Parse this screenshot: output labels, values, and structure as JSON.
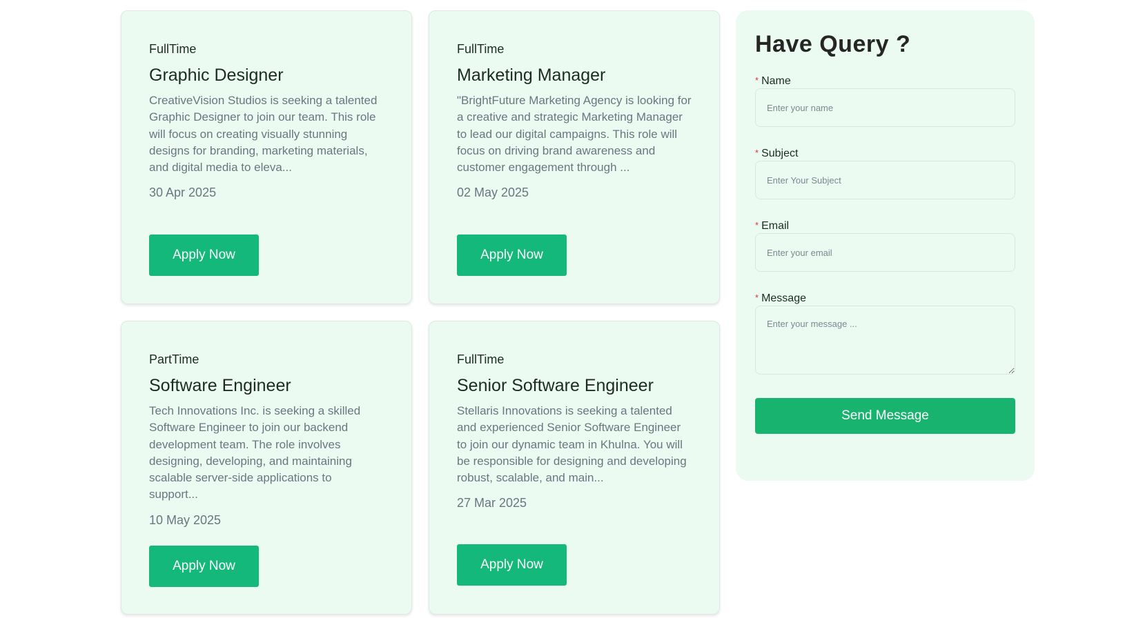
{
  "jobs": [
    {
      "type": "FullTime",
      "title": "Graphic Designer",
      "description": "CreativeVision Studios is seeking a talented Graphic Designer to join our team. This role will focus on creating visually stunning designs for branding, marketing materials, and digital media to eleva...",
      "date": "30 Apr 2025",
      "apply_label": "Apply Now"
    },
    {
      "type": "FullTime",
      "title": "Marketing Manager",
      "description": "\"BrightFuture Marketing Agency is looking for a creative and strategic Marketing Manager to lead our digital campaigns. This role will focus on driving brand awareness and customer engagement through ...",
      "date": "02 May 2025",
      "apply_label": "Apply Now"
    },
    {
      "type": "PartTime",
      "title": "Software Engineer",
      "description": "Tech Innovations Inc. is seeking a skilled Software Engineer to join our backend development team. The role involves designing, developing, and maintaining scalable server-side applications to support...",
      "date": "10 May 2025",
      "apply_label": "Apply Now"
    },
    {
      "type": "FullTime",
      "title": "Senior Software Engineer",
      "description": "Stellaris Innovations is seeking a talented and experienced Senior Software Engineer to join our dynamic team in Khulna. You will be responsible for designing and developing robust, scalable, and main...",
      "date": "27 Mar 2025",
      "apply_label": "Apply Now"
    }
  ],
  "query": {
    "title": "Have Query ?",
    "required_marker": "*",
    "name_label": "Name",
    "name_placeholder": "Enter your name",
    "subject_label": "Subject",
    "subject_placeholder": "Enter Your Subject",
    "email_label": "Email",
    "email_placeholder": "Enter your email",
    "message_label": "Message",
    "message_placeholder": "Enter your message ...",
    "send_label": "Send Message"
  },
  "colors": {
    "card_background": "#ebfbf2",
    "accent": "#14b87a",
    "required": "#e0333a"
  }
}
